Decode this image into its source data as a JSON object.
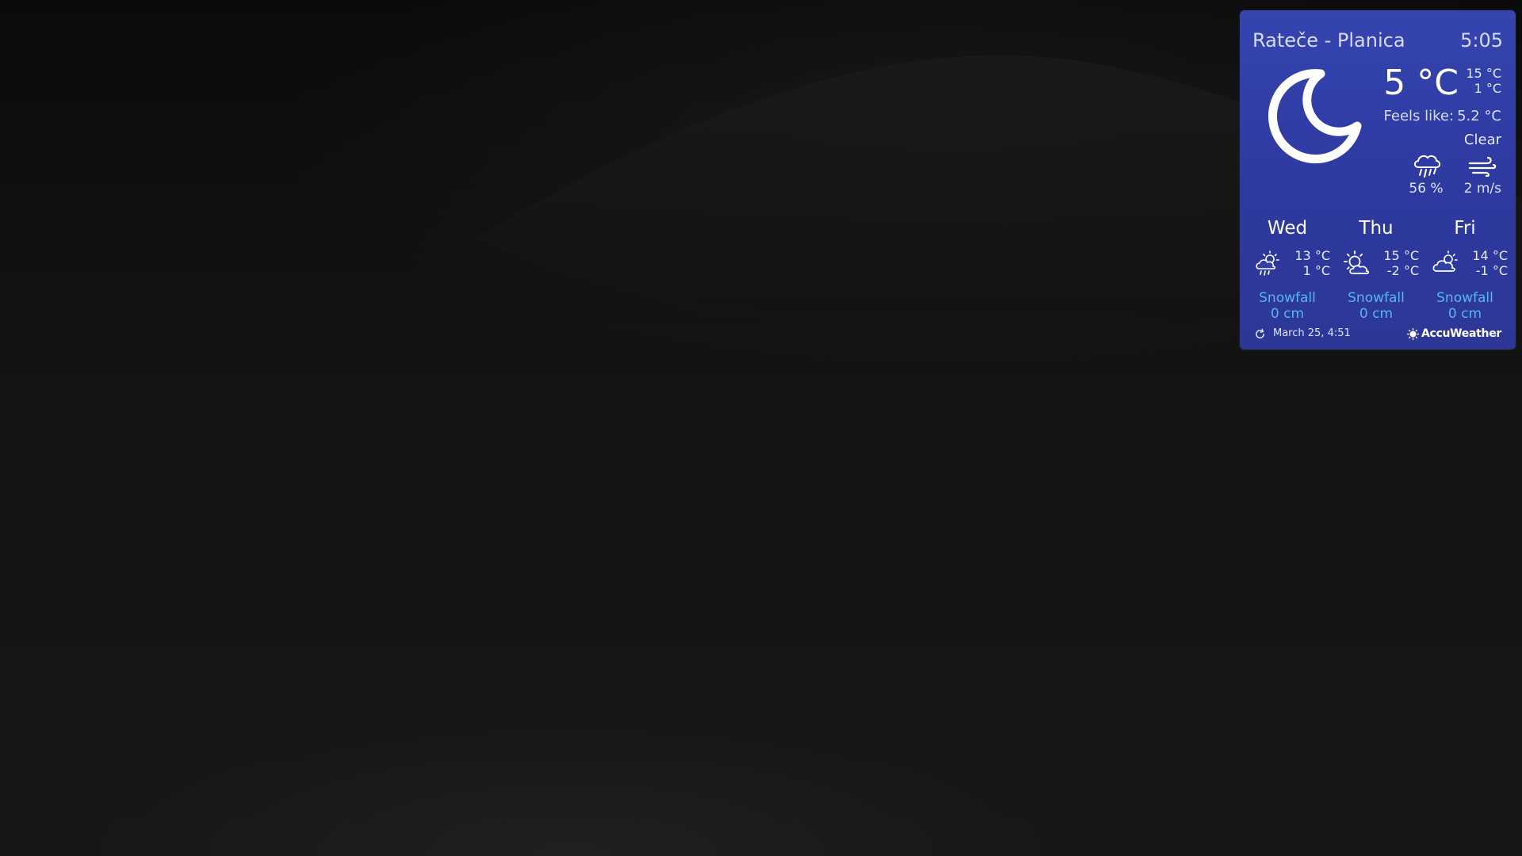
{
  "camera": {
    "description_icon": "night-webcam-view"
  },
  "widget": {
    "location": "Rateče - Planica",
    "time": "5:05",
    "current": {
      "icon": "moon-clear-icon",
      "temperature": "5 °C",
      "high": "15 °C",
      "low": "1 °C",
      "feels_like_label": "Feels like:",
      "feels_like_value": "5.2 °C",
      "condition": "Clear",
      "precip_icon": "rain-cloud-icon",
      "precip_value": "56 %",
      "wind_icon": "wind-icon",
      "wind_value": "2 m/s"
    },
    "forecast": [
      {
        "day": "Wed",
        "icon": "partly-sunny-showers-icon",
        "high": "13 °C",
        "low": "1 °C",
        "snow_label": "Snowfall",
        "snow_value": "0 cm"
      },
      {
        "day": "Thu",
        "icon": "mostly-sunny-icon",
        "high": "15 °C",
        "low": "-2 °C",
        "snow_label": "Snowfall",
        "snow_value": "0 cm"
      },
      {
        "day": "Fri",
        "icon": "partly-cloudy-icon",
        "high": "14 °C",
        "low": "-1 °C",
        "snow_label": "Snowfall",
        "snow_value": "0 cm"
      }
    ],
    "footer": {
      "updated": "March 25, 4:51",
      "brand": "AccuWeather"
    },
    "colors": {
      "panel": "#3140a6",
      "snow_text": "#55b6f0"
    }
  }
}
